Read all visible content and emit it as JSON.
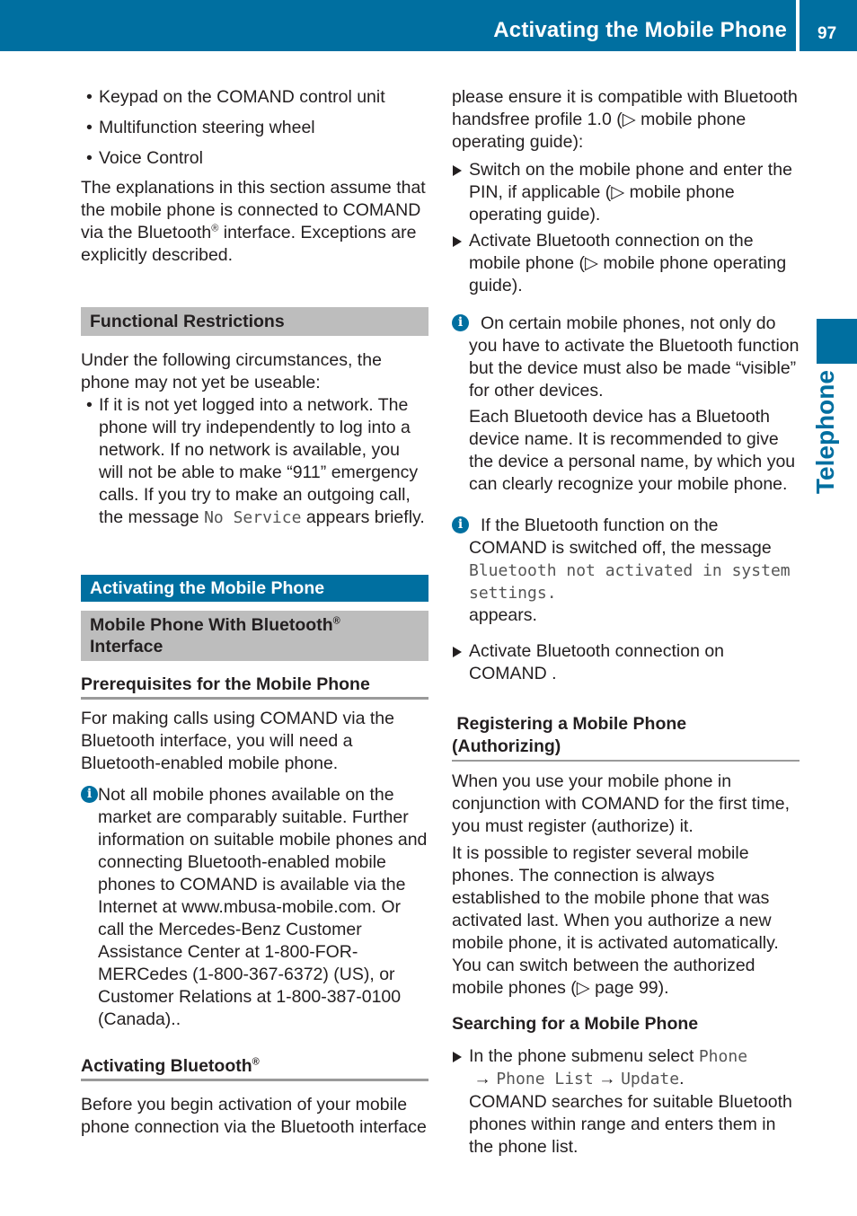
{
  "header": {
    "title": "Activating the Mobile Phone",
    "page_number": "97"
  },
  "side_tab": {
    "label": "Telephone"
  },
  "left_column": {
    "bullets": [
      "Keypad on the COMAND control unit",
      "Multifunction steering wheel",
      "Voice Control"
    ],
    "intro": {
      "part1": "The explanations in this section assume that the mobile phone is connected to COMAND via the Bluetooth",
      "sup": "®",
      "part2": " interface. Exceptions are explicitly described."
    },
    "functional_restrictions": {
      "heading": "Functional Restrictions",
      "intro": "Under the following circumstances, the phone may not yet be useable:",
      "bullet_part1": "If it is not yet logged into a network. The phone will try independently to log into a network. If no network is available, you will not be able to make “911” emergency calls. If you try to make an outgoing call, the message ",
      "bullet_code": "No Service",
      "bullet_part2": " appears briefly."
    },
    "activating_heading": "Activating the Mobile Phone",
    "bluetooth_interface_heading": {
      "part1": " Mobile Phone With Bluetooth",
      "sup": "®",
      "part2": "Interface"
    },
    "prerequisites": {
      "heading": "Prerequisites for the Mobile Phone",
      "text": "For making calls using COMAND via the Bluetooth interface, you will need a Bluetooth-enabled mobile phone.",
      "info": "Not all mobile phones available on the market are comparably suitable. Further information on suitable mobile phones and connecting Bluetooth-enabled mobile phones to COMAND is available via the Internet at www.mbusa-mobile.com. Or call the Mercedes-Benz Customer Assistance Center at 1-800-FOR-MERCedes (1-800-367-6372) (US), or Customer Relations at 1-800-387-0100 (Canada).."
    },
    "activating_bluetooth": {
      "heading": "Activating Bluetooth",
      "sup": "®",
      "text": "Before you begin activation of your mobile phone connection via the Bluetooth interface"
    }
  },
  "right_column": {
    "continuation": "please ensure it is compatible with Bluetooth handsfree profile 1.0 (▷ mobile phone operating guide):",
    "steps": [
      "Switch on the mobile phone and enter the PIN, if applicable (▷ mobile phone operating guide).",
      "Activate Bluetooth connection on the mobile phone (▷ mobile phone operating guide)."
    ],
    "info1": {
      "line": "On certain mobile phones, not only do you have to activate the Bluetooth function but the device must also be made “visible” for other devices.",
      "followup": "Each Bluetooth device has a Bluetooth device name. It is recommended to give the device a personal name, by which you can clearly recognize your mobile phone."
    },
    "info2": {
      "part1": "If the Bluetooth function on the COMAND is switched off, the message ",
      "code": "Bluetooth not activated in system settings.",
      "part2": " appears."
    },
    "step3": "Activate Bluetooth connection on COMAND .",
    "registering": {
      "heading": " Registering a Mobile Phone (Authorizing)",
      "para1": "When you use your mobile phone in conjunction with COMAND for the first time, you must register (authorize) it.",
      "para2": "It is possible to register several mobile phones. The connection is always established to the mobile phone that was activated last. When you authorize a new mobile phone, it is activated automatically. You can switch between the authorized mobile phones (▷ page 99)."
    },
    "searching": {
      "heading": "Searching for a Mobile Phone",
      "step_prefix": "In the phone submenu select ",
      "menu_phone": "Phone",
      "arrow": "→",
      "menu_list": "Phone List",
      "menu_update": "Update",
      "step_suffix": ".",
      "result": "COMAND searches for suitable Bluetooth phones within range and enters them in the phone list."
    }
  }
}
